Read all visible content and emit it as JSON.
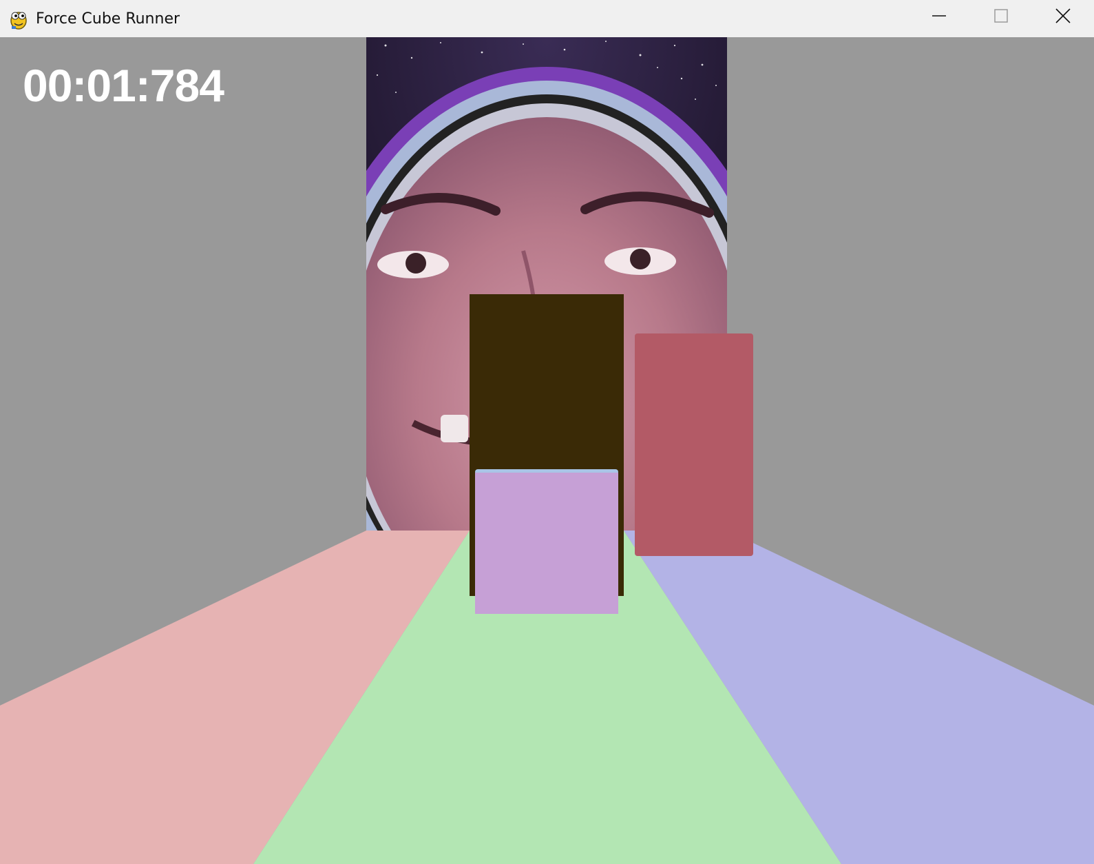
{
  "window": {
    "title": "Force Cube Runner",
    "app_icon": "pygame-snake-icon",
    "controls": [
      "minimize-icon",
      "maximize-icon",
      "close-icon"
    ]
  },
  "hud": {
    "timer": "00:01:784"
  },
  "scene": {
    "background_color": "#999999",
    "backdrop_image": "astronaut-face-in-space-helmet",
    "lanes": [
      {
        "name": "left",
        "color": "#e6b3b3"
      },
      {
        "name": "center",
        "color": "#b3e6b3"
      },
      {
        "name": "right",
        "color": "#b3b3e6"
      }
    ],
    "obstacles": [
      {
        "name": "dark-obstacle",
        "color": "#3a2a06",
        "lane": "center"
      },
      {
        "name": "red-obstacle",
        "color": "#b35a66",
        "lane": "right"
      }
    ],
    "player": {
      "name": "player-cube",
      "color": "#c6a0d6",
      "top_color": "#a9c4e6",
      "lane": "center"
    }
  }
}
